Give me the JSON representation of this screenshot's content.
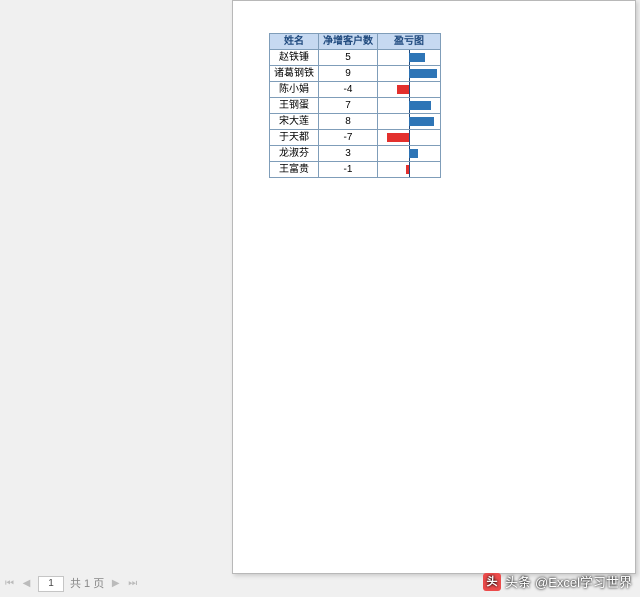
{
  "table": {
    "headers": [
      "姓名",
      "净增客户数",
      "盈亏图"
    ],
    "rows": [
      {
        "name": "赵铁锤",
        "value": 5
      },
      {
        "name": "诸葛钢铁",
        "value": 9
      },
      {
        "name": "陈小娟",
        "value": -4
      },
      {
        "name": "王钢蛋",
        "value": 7
      },
      {
        "name": "宋大莲",
        "value": 8
      },
      {
        "name": "于天都",
        "value": -7
      },
      {
        "name": "龙淑芬",
        "value": 3
      },
      {
        "name": "王富贵",
        "value": -1
      }
    ],
    "max_abs": 9
  },
  "pager": {
    "current": "1",
    "total_label": "共 1 页"
  },
  "watermark": {
    "prefix": "头条",
    "handle": "@Excel学习世界",
    "icon_text": "头"
  }
}
